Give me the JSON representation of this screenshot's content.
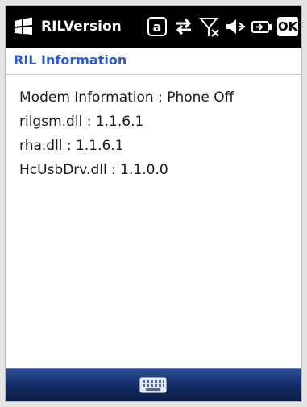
{
  "statusbar": {
    "app_title": "RILVersion",
    "ok_label": "OK"
  },
  "header": {
    "title": "RIL Information"
  },
  "content": {
    "lines": [
      "Modem Information : Phone Off",
      "rilgsm.dll : 1.1.6.1",
      "rha.dll : 1.1.6.1",
      "HcUsbDrv.dll : 1.1.0.0"
    ]
  },
  "icons": {
    "start": "windows-start-icon",
    "status": [
      "at-sign-icon",
      "data-arrows-icon",
      "signal-off-icon",
      "speaker-muted-icon",
      "battery-charging-icon"
    ],
    "input": "keyboard-icon"
  }
}
